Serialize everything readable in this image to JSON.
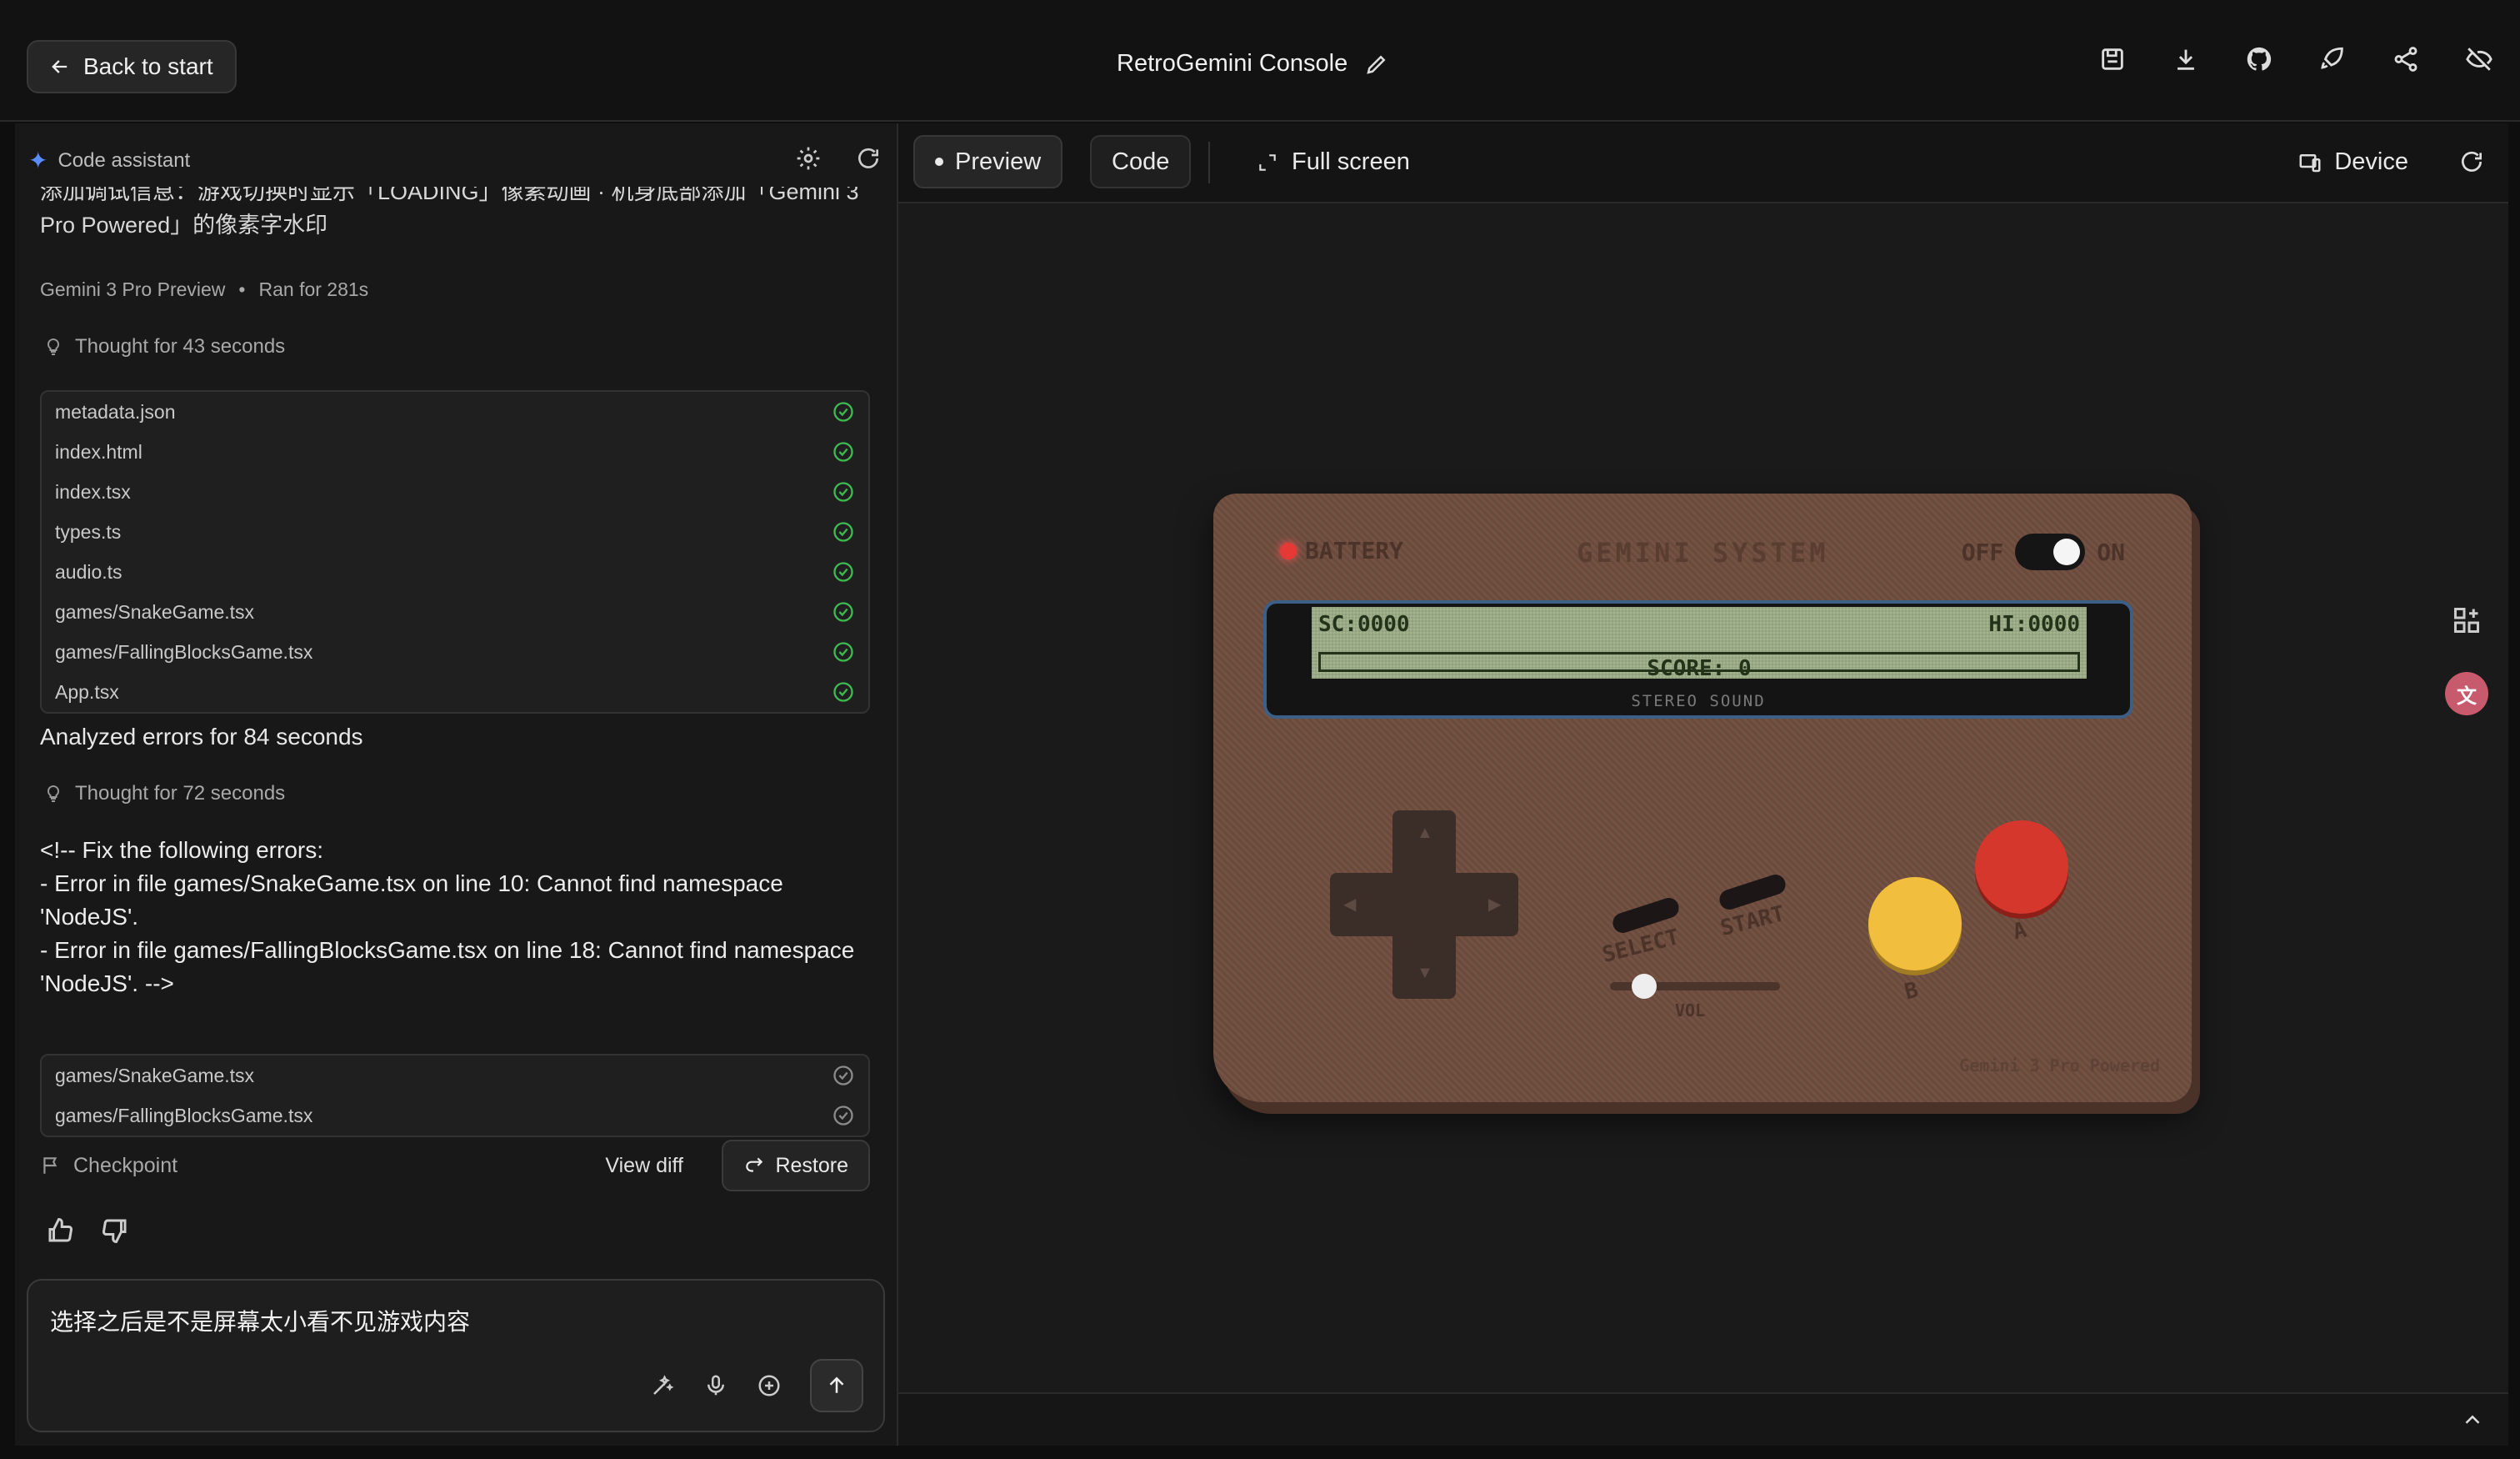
{
  "header": {
    "back_label": "Back to start",
    "title": "RetroGemini Console",
    "icons": [
      "save-icon",
      "download-icon",
      "github-icon",
      "rocket-icon",
      "share-icon",
      "hide-icon"
    ]
  },
  "assistant": {
    "title": "Code assistant",
    "cut_text": "添加调试信息：游戏切换时显示「LOADING」像素动画 · 机身底部添加「Gemini 3 Pro Powered」的像素字水印",
    "model": "Gemini 3 Pro Preview",
    "ran_for": "Ran for 281s",
    "thought_1": "Thought for 43 seconds",
    "files_1": [
      "metadata.json",
      "index.html",
      "index.tsx",
      "types.ts",
      "audio.ts",
      "games/SnakeGame.tsx",
      "games/FallingBlocksGame.tsx",
      "App.tsx"
    ],
    "analyzed": "Analyzed errors for 84 seconds",
    "thought_2": "Thought for 72 seconds",
    "fix_line_1": "<!-- Fix the following errors:",
    "fix_line_2": "- Error in file games/SnakeGame.tsx on line 10: Cannot find namespace 'NodeJS'.",
    "fix_line_3": "- Error in file games/FallingBlocksGame.tsx on line 18: Cannot find namespace 'NodeJS'. -->",
    "files_2": [
      "games/SnakeGame.tsx",
      "games/FallingBlocksGame.tsx"
    ],
    "checkpoint": "Checkpoint",
    "view_diff": "View diff",
    "restore": "Restore",
    "input_value": "选择之后是不是屏幕太小看不见游戏内容"
  },
  "preview": {
    "tab_preview": "Preview",
    "tab_code": "Code",
    "fullscreen": "Full screen",
    "device": "Device"
  },
  "console": {
    "battery": "BATTERY",
    "system": "GEMINI SYSTEM",
    "off": "OFF",
    "on": "ON",
    "sc": "SC:0000",
    "hi": "HI:0000",
    "score": "SCORE: 0",
    "stereo": "STEREO SOUND",
    "select": "SELECT",
    "start": "START",
    "vol": "VOL",
    "volume_level": 0.2,
    "b": "B",
    "a": "A",
    "watermark": "Gemini 3 Pro Powered"
  },
  "colors": {
    "accent_blue": "#5b8cff",
    "check_green": "#3fb950",
    "console_body": "#6e4c3e",
    "lcd": "#a3b58e",
    "button_a": "#d6372c",
    "button_b": "#f2be3e"
  }
}
